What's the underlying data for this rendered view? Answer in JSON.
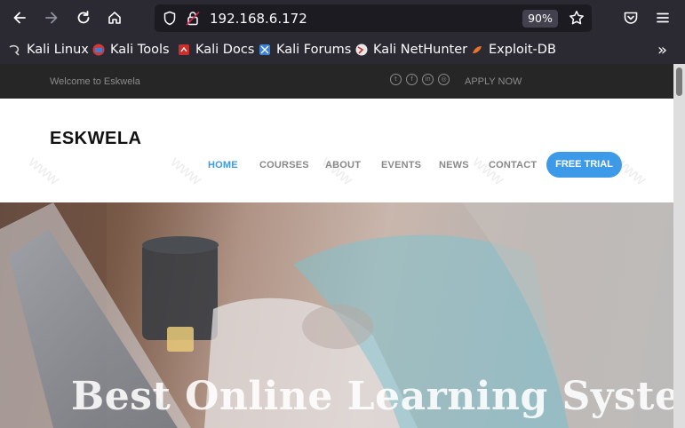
{
  "browser": {
    "url": "192.168.6.172",
    "zoom": "90%",
    "icons": [
      "back-arrow-icon",
      "forward-arrow-icon",
      "reload-icon",
      "home-icon",
      "shield-icon",
      "lock-insecure-icon",
      "star-icon",
      "pocket-icon",
      "menu-icon"
    ]
  },
  "bookmarks": [
    {
      "label": "Kali Linux"
    },
    {
      "label": "Kali Tools"
    },
    {
      "label": "Kali Docs"
    },
    {
      "label": "Kali Forums"
    },
    {
      "label": "Kali NetHunter"
    },
    {
      "label": "Exploit-DB"
    }
  ],
  "site": {
    "topbar": {
      "welcome": "Welcome to Eskwela",
      "apply": "APPLY NOW",
      "social_icons": [
        "twitter-icon",
        "facebook-icon",
        "linkedin-icon",
        "dribbble-icon"
      ]
    },
    "logo": "ESKWELA",
    "nav": [
      {
        "label": "HOME",
        "active": true
      },
      {
        "label": "COURSES"
      },
      {
        "label": "ABOUT"
      },
      {
        "label": "EVENTS"
      },
      {
        "label": "NEWS"
      },
      {
        "label": "CONTACT"
      }
    ],
    "cta": "FREE TRIAL",
    "hero_title": "Best Online Learning System"
  },
  "colors": {
    "accent": "#3d9ae8",
    "browser_bg": "#2b2a33",
    "topbar_bg": "#262626"
  }
}
